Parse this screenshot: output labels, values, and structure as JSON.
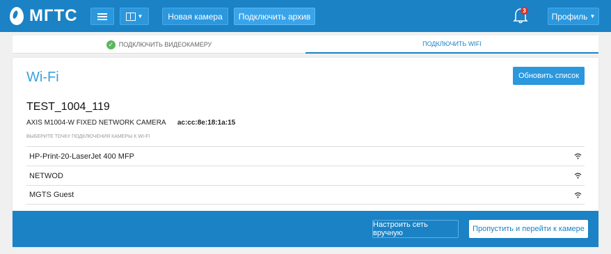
{
  "navbar": {
    "logo_text": "МГТС",
    "new_camera_label": "Новая камера",
    "connect_archive_label": "Подключить архив",
    "notification_count": "3",
    "profile_label": "Профиль",
    "bg_color": "#1a82c5"
  },
  "steps": [
    {
      "label": "подключить видеокамеру",
      "done": true
    },
    {
      "label": "подключить wifi",
      "active": true
    }
  ],
  "panel": {
    "title": "Wi-Fi",
    "refresh_label": "Обновить список",
    "device_name": "TEST_1004_119",
    "device_model": "AXIS M1004-W FIXED NETWORK CAMERA",
    "device_mac": "ac:cc:8e:18:1a:15",
    "hint": "Выберите точку подключения камеры к WI-FI",
    "networks": [
      {
        "ssid": "HP-Print-20-LaserJet 400 MFP",
        "icon": "wifi-icon"
      },
      {
        "ssid": "NETWOD",
        "icon": "wifi-icon"
      },
      {
        "ssid": "MGTS Guest",
        "icon": "wifi-icon"
      }
    ]
  },
  "footer": {
    "manual_label": "Настроить сеть вручную",
    "skip_label": "Пропустить и перейти к камере"
  }
}
